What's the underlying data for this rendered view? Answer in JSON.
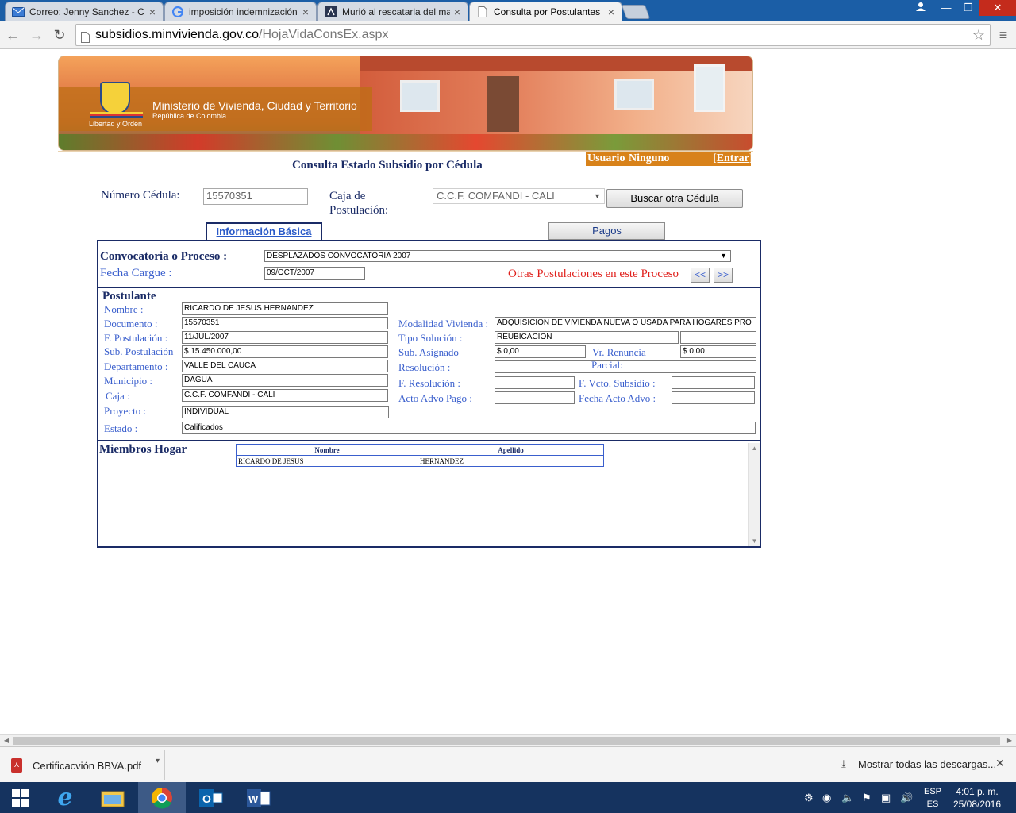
{
  "browser": {
    "tabs": [
      {
        "label": "Correo: Jenny Sanchez - C",
        "icon": "mail-icon"
      },
      {
        "label": "imposición indemnización",
        "icon": "google-icon"
      },
      {
        "label": "Murió al rescatarla del ma",
        "icon": "news-icon"
      },
      {
        "label": "Consulta por Postulantes",
        "icon": "page-icon",
        "active": true
      }
    ],
    "url_host": "subsidios.minvivienda.gov.co",
    "url_path": "/HojaVidaConsEx.aspx"
  },
  "banner": {
    "ministry": "Ministerio de Vivienda, Ciudad y Territorio",
    "country": "República de Colombia",
    "motto": "Libertad y Orden"
  },
  "header": {
    "title": "Consulta Estado Subsidio por Cédula",
    "user_label": "Usuario",
    "user_value": "Ninguno",
    "login_link": "[Entrar]"
  },
  "search": {
    "cedula_label": "Número Cédula:",
    "cedula_value": "15570351",
    "caja_label_1": "Caja de",
    "caja_label_2": "Postulación:",
    "caja_value": "C.C.F. COMFANDI - CALI",
    "button": "Buscar otra Cédula"
  },
  "tabs": {
    "info": "Información Básica",
    "pagos": "Pagos"
  },
  "convocatoria": {
    "label": "Convocatoria o Proceso :",
    "value": "DESPLAZADOS CONVOCATORIA 2007",
    "fecha_label": "Fecha Cargue :",
    "fecha_value": "09/OCT/2007",
    "otras_label": "Otras Postulaciones en este Proceso",
    "prev": "<<",
    "next": ">>"
  },
  "postulante": {
    "section_title": "Postulante",
    "labels": {
      "nombre": "Nombre :",
      "documento": "Documento :",
      "f_postulacion": "F. Postulación :",
      "sub_postulacion": "Sub. Postulación",
      "departamento": "Departamento :",
      "municipio": "Municipio :",
      "caja": "Caja :",
      "proyecto": "Proyecto :",
      "estado": "Estado :",
      "modalidad": "Modalidad Vivienda :",
      "tipo_solucion": "Tipo Solución :",
      "sub_asignado": "Sub. Asignado",
      "vr_renuncia": "Vr. Renuncia",
      "parcial": "Parcial:",
      "resolucion": "Resolución :",
      "f_resolucion": "F. Resolución :",
      "f_vcto": "F. Vcto. Subsidio :",
      "acto_pago": "Acto Advo Pago :",
      "fecha_acto": "Fecha Acto Advo :"
    },
    "values": {
      "nombre": "RICARDO DE JESUS HERNANDEZ",
      "documento": "15570351",
      "f_postulacion": "11/JUL/2007",
      "sub_postulacion": "$ 15.450.000,00",
      "departamento": "VALLE DEL CAUCA",
      "municipio": "DAGUA",
      "caja": "C.C.F. COMFANDI - CALI",
      "proyecto": "INDIVIDUAL",
      "estado": "Calificados",
      "modalidad": "ADQUISICION DE VIVIENDA NUEVA O USADA PARA HOGARES PRO",
      "tipo_solucion": "REUBICACION",
      "tipo_solucion_extra": "",
      "sub_asignado": "$ 0,00",
      "vr_renuncia": "$ 0,00",
      "resolucion": "",
      "f_resolucion": "",
      "f_vcto": "",
      "acto_pago": "",
      "fecha_acto": ""
    }
  },
  "miembros": {
    "title": "Miembros Hogar",
    "columns": [
      "Nombre",
      "Apellido"
    ],
    "rows": [
      [
        "RICARDO DE JESUS",
        "HERNANDEZ"
      ]
    ]
  },
  "downloads": {
    "file": "Certificacvión BBVA.pdf",
    "show_all": "Mostrar todas las descargas..."
  },
  "taskbar": {
    "lang_1": "ESP",
    "lang_2": "ES",
    "time": "4:01 p. m.",
    "date": "25/08/2016"
  }
}
